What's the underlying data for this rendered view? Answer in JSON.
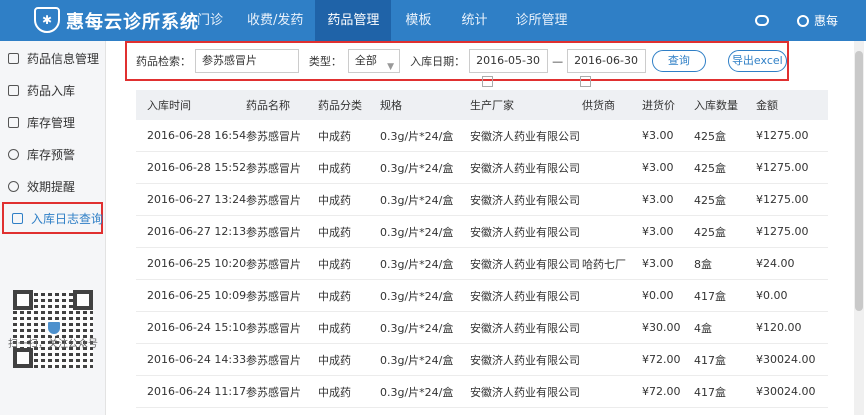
{
  "app": {
    "title": "惠每云诊所系统",
    "user": "惠每"
  },
  "nav": [
    {
      "label": "门诊"
    },
    {
      "label": "收费/发药"
    },
    {
      "label": "药品管理"
    },
    {
      "label": "模板"
    },
    {
      "label": "统计"
    },
    {
      "label": "诊所管理"
    }
  ],
  "sidebar": {
    "items": [
      {
        "label": "药品信息管理"
      },
      {
        "label": "药品入库"
      },
      {
        "label": "库存管理"
      },
      {
        "label": "库存预警"
      },
      {
        "label": "效期提醒"
      },
      {
        "label": "入库日志查询"
      }
    ],
    "qr_caption": "扫一扫，关注公众号"
  },
  "filter": {
    "search_label": "药品检索：",
    "search_value": "参苏感冒片",
    "type_label": "类型：",
    "type_value": "全部",
    "date_label": "入库日期：",
    "date_from": "2016-05-30",
    "date_sep": "—",
    "date_to": "2016-06-30",
    "query_label": "查询",
    "export_label": "导出excel"
  },
  "table": {
    "headers": [
      "入库时间",
      "药品名称",
      "药品分类",
      "规格",
      "生产厂家",
      "供货商",
      "进货价",
      "入库数量",
      "金额"
    ],
    "rows": [
      [
        "2016-06-28 16:54",
        "参苏感冒片",
        "中成药",
        "0.3g/片*24/盒",
        "安徽济人药业有限公司",
        "",
        "¥3.00",
        "425盒",
        "¥1275.00"
      ],
      [
        "2016-06-28 15:52",
        "参苏感冒片",
        "中成药",
        "0.3g/片*24/盒",
        "安徽济人药业有限公司",
        "",
        "¥3.00",
        "425盒",
        "¥1275.00"
      ],
      [
        "2016-06-27 13:24",
        "参苏感冒片",
        "中成药",
        "0.3g/片*24/盒",
        "安徽济人药业有限公司",
        "",
        "¥3.00",
        "425盒",
        "¥1275.00"
      ],
      [
        "2016-06-27 12:13",
        "参苏感冒片",
        "中成药",
        "0.3g/片*24/盒",
        "安徽济人药业有限公司",
        "",
        "¥3.00",
        "425盒",
        "¥1275.00"
      ],
      [
        "2016-06-25 10:20",
        "参苏感冒片",
        "中成药",
        "0.3g/片*24/盒",
        "安徽济人药业有限公司",
        "哈药七厂",
        "¥3.00",
        "8盒",
        "¥24.00"
      ],
      [
        "2016-06-25 10:09",
        "参苏感冒片",
        "中成药",
        "0.3g/片*24/盒",
        "安徽济人药业有限公司",
        "",
        "¥0.00",
        "417盒",
        "¥0.00"
      ],
      [
        "2016-06-24 15:10",
        "参苏感冒片",
        "中成药",
        "0.3g/片*24/盒",
        "安徽济人药业有限公司",
        "",
        "¥30.00",
        "4盒",
        "¥120.00"
      ],
      [
        "2016-06-24 14:33",
        "参苏感冒片",
        "中成药",
        "0.3g/片*24/盒",
        "安徽济人药业有限公司",
        "",
        "¥72.00",
        "417盒",
        "¥30024.00"
      ],
      [
        "2016-06-24 11:17",
        "参苏感冒片",
        "中成药",
        "0.3g/片*24/盒",
        "安徽济人药业有限公司",
        "",
        "¥72.00",
        "417盒",
        "¥30024.00"
      ]
    ]
  },
  "colors": {
    "primary": "#2f7fc6",
    "nav_active": "#1f63a8",
    "highlight": "#e03030"
  },
  "icons": {
    "logo": "shield-logo-icon",
    "wechat": "wechat-icon",
    "user": "user-icon",
    "calendar": "calendar-icon"
  }
}
